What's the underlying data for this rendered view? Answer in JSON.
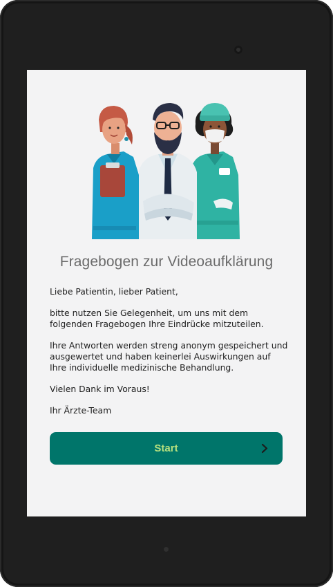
{
  "screen": {
    "title": "Fragebogen zur Videoaufklärung",
    "paragraphs": [
      "Liebe Patientin, lieber Patient,",
      "bitte nutzen Sie Gelegenheit, um uns mit dem folgenden Fragebogen Ihre Eindrücke mitzuteilen.",
      "Ihre Antworten werden streng anonym gespeichert und ausgewertet und haben keinerlei Auswirkungen auf Ihre individuelle medizinische Behandlung.",
      "Vielen Dank im Voraus!",
      "Ihr Ärzte-Team"
    ],
    "start_button": {
      "label": "Start",
      "icon": "chevron-right-icon"
    }
  },
  "illustration": {
    "name": "medical-team-illustration"
  },
  "colors": {
    "screen_background": "#f3f3f4",
    "button_background": "#00756a",
    "button_text": "#b6e07e",
    "title_text": "#6b6b6b",
    "body_text": "#1e1e1e"
  }
}
